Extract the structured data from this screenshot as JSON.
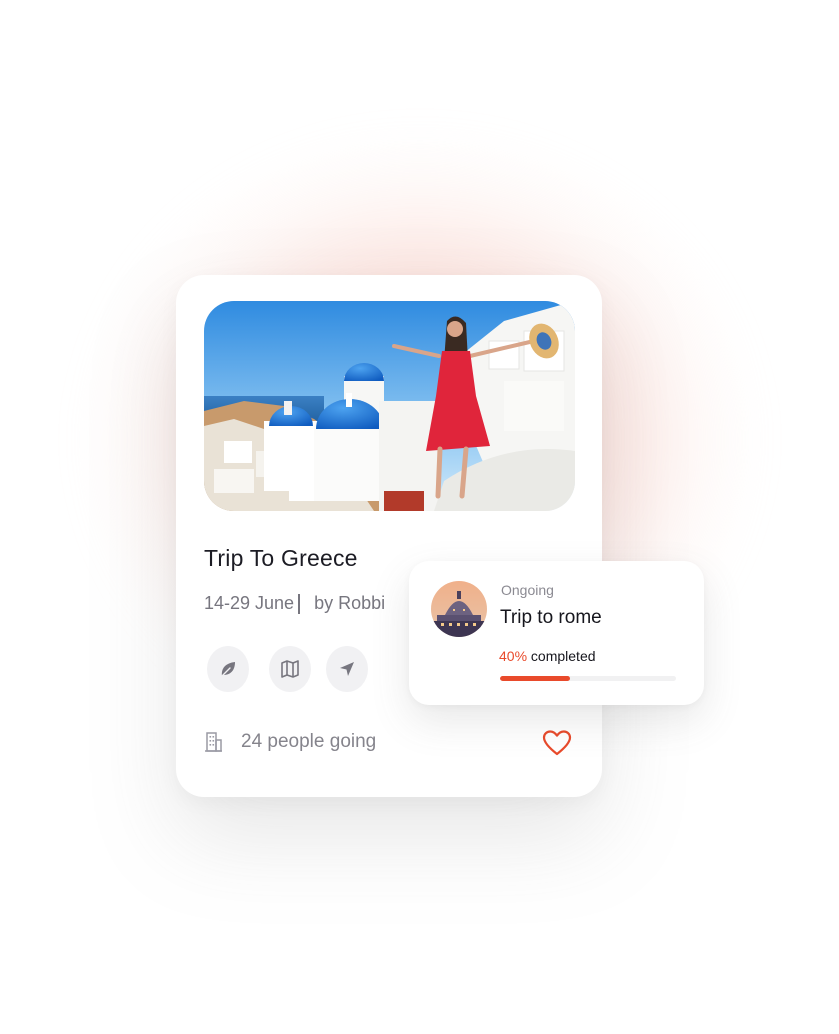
{
  "trip_card": {
    "title": "Trip To Greece",
    "dates": "14-29 June",
    "author": "by Robbi",
    "actions": [
      {
        "icon": "leaf-icon"
      },
      {
        "icon": "map-icon"
      },
      {
        "icon": "send-icon"
      }
    ],
    "attendance": "24 people going",
    "favorite_icon": "heart-icon"
  },
  "ongoing_trip": {
    "status": "Ongoing",
    "name": "Trip to rome",
    "progress_percent": "40%",
    "progress_label": " completed",
    "progress_fraction": 0.4
  },
  "colors": {
    "accent": "#e94a2b",
    "icon_gray": "#77767f"
  }
}
